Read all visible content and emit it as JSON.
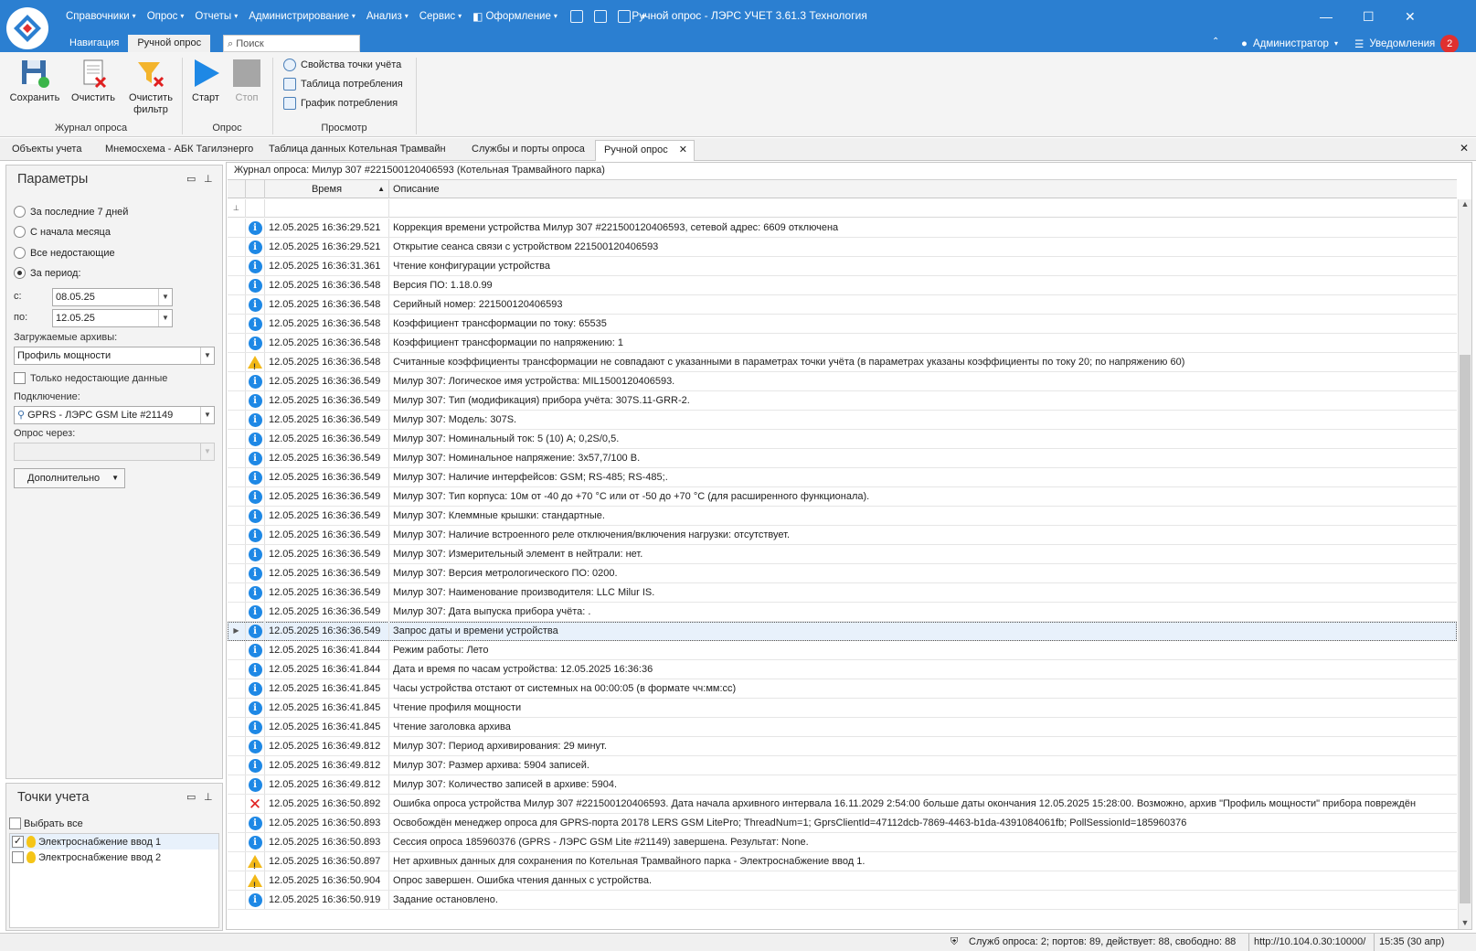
{
  "window": {
    "title": "Ручной опрос - ЛЭРС УЧЕТ 3.61.3 Технология"
  },
  "menu": [
    "Справочники",
    "Опрос",
    "Отчеты",
    "Администрирование",
    "Анализ",
    "Сервис",
    "Оформление"
  ],
  "ribbon_tabs": [
    "Навигация",
    "Ручной опрос"
  ],
  "search": {
    "placeholder": "Поиск"
  },
  "user": {
    "name": "Администратор",
    "notifications_label": "Уведомления",
    "notifications_count": "2"
  },
  "ribbon": {
    "save": "Сохранить",
    "clear": "Очистить",
    "clear_filter_1": "Очистить",
    "clear_filter_2": "фильтр",
    "start": "Старт",
    "stop": "Стоп",
    "group_journal": "Журнал опроса",
    "group_poll": "Опрос",
    "group_view": "Просмотр",
    "props": "Свойства точки учёта",
    "table": "Таблица потребления",
    "chart": "График потребления"
  },
  "doc_tabs": [
    "Объекты учета",
    "Мнемосхема - АБК Тагилэнерго",
    "Таблица данных Котельная Трамвайн",
    "Службы и порты опроса",
    "Ручной опрос"
  ],
  "params": {
    "title": "Параметры",
    "r1": "За последние 7 дней",
    "r2": "С начала месяца",
    "r3": "Все недостающие",
    "r4": "За период:",
    "from_label": "с:",
    "from_value": "08.05.25",
    "to_label": "по:",
    "to_value": "12.05.25",
    "archives_label": "Загружаемые архивы:",
    "archives_value": "Профиль мощности",
    "only_missing": "Только недостающие данные",
    "connection_label": "Подключение:",
    "connection_value": "GPRS - ЛЭРС GSM Lite #21149",
    "via_label": "Опрос через:",
    "advanced": "Дополнительно"
  },
  "points": {
    "title": "Точки учета",
    "select_all": "Выбрать все",
    "items": [
      "Электроснабжение ввод 1",
      "Электроснабжение ввод 2"
    ]
  },
  "journal": {
    "caption": "Журнал опроса: Милур 307 #221500120406593 (Котельная Трамвайного парка)",
    "col_time": "Время",
    "col_desc": "Описание",
    "rows": [
      {
        "t": "12.05.2025 16:36:29.521",
        "d": "Коррекция времени устройства Милур 307 #221500120406593, сетевой адрес: 6609 отключена"
      },
      {
        "t": "12.05.2025 16:36:29.521",
        "d": "Открытие сеанса связи с устройством 221500120406593"
      },
      {
        "t": "12.05.2025 16:36:31.361",
        "d": "Чтение конфигурации устройства"
      },
      {
        "t": "12.05.2025 16:36:36.548",
        "d": "Версия ПО: 1.18.0.99"
      },
      {
        "t": "12.05.2025 16:36:36.548",
        "d": "Серийный номер: 221500120406593"
      },
      {
        "t": "12.05.2025 16:36:36.548",
        "d": "Коэффициент трансформации по току: 65535"
      },
      {
        "t": "12.05.2025 16:36:36.548",
        "d": "Коэффициент трансформации по напряжению: 1"
      },
      {
        "t": "12.05.2025 16:36:36.548",
        "d": "Считанные коэффициенты трансформации не совпадают с указанными в параметрах точки учёта (в параметрах указаны коэффициенты по току 20; по напряжению 60)"
      },
      {
        "t": "12.05.2025 16:36:36.549",
        "d": "Милур 307: Логическое имя устройства: MIL1500120406593."
      },
      {
        "t": "12.05.2025 16:36:36.549",
        "d": "Милур 307: Тип (модификация) прибора учёта: 307S.11-GRR-2."
      },
      {
        "t": "12.05.2025 16:36:36.549",
        "d": "Милур 307: Модель: 307S."
      },
      {
        "t": "12.05.2025 16:36:36.549",
        "d": "Милур 307: Номинальный ток: 5 (10) А; 0,2S/0,5."
      },
      {
        "t": "12.05.2025 16:36:36.549",
        "d": "Милур 307: Номинальное напряжение: 3x57,7/100 В."
      },
      {
        "t": "12.05.2025 16:36:36.549",
        "d": "Милур 307: Наличие интерфейсов:  GSM; RS-485; RS-485;."
      },
      {
        "t": "12.05.2025 16:36:36.549",
        "d": "Милур 307: Тип корпуса: 10м от -40 до +70 °С или от -50 до +70 °С (для расширенного функционала)."
      },
      {
        "t": "12.05.2025 16:36:36.549",
        "d": "Милур 307: Клеммные крышки: стандартные."
      },
      {
        "t": "12.05.2025 16:36:36.549",
        "d": "Милур 307: Наличие встроенного реле отключения/включения нагрузки: отсутствует."
      },
      {
        "t": "12.05.2025 16:36:36.549",
        "d": "Милур 307: Измерительный элемент в нейтрали: нет."
      },
      {
        "t": "12.05.2025 16:36:36.549",
        "d": "Милур 307: Версия метрологического ПО: 0200."
      },
      {
        "t": "12.05.2025 16:36:36.549",
        "d": "Милур 307: Наименование производителя: LLC Milur IS."
      },
      {
        "t": "12.05.2025 16:36:36.549",
        "d": "Милур 307: Дата выпуска прибора учёта:                ."
      },
      {
        "t": "12.05.2025 16:36:36.549",
        "d": "Запрос даты и времени устройства"
      },
      {
        "t": "12.05.2025 16:36:41.844",
        "d": "Режим работы: Лето"
      },
      {
        "t": "12.05.2025 16:36:41.844",
        "d": "Дата и время по часам устройства: 12.05.2025 16:36:36"
      },
      {
        "t": "12.05.2025 16:36:41.845",
        "d": "Часы устройства отстают от системных на 00:00:05 (в формате чч:мм:сс)"
      },
      {
        "t": "12.05.2025 16:36:41.845",
        "d": "Чтение профиля мощности"
      },
      {
        "t": "12.05.2025 16:36:41.845",
        "d": "Чтение заголовка архива"
      },
      {
        "t": "12.05.2025 16:36:49.812",
        "d": "Милур 307: Период архивирования: 29 минут."
      },
      {
        "t": "12.05.2025 16:36:49.812",
        "d": "Милур 307: Размер архива: 5904 записей."
      },
      {
        "t": "12.05.2025 16:36:49.812",
        "d": "Милур 307: Количество записей в архиве: 5904."
      },
      {
        "t": "12.05.2025 16:36:50.892",
        "d": "Ошибка опроса устройства Милур 307 #221500120406593. Дата начала архивного интервала 16.11.2029 2:54:00 больше даты окончания 12.05.2025 15:28:00. Возможно, архив \"Профиль мощности\" прибора повреждён"
      },
      {
        "t": "12.05.2025 16:36:50.893",
        "d": "Освобождён менеджер опроса для GPRS-порта 20178 LERS GSM LitePro; ThreadNum=1; GprsClientId=47112dcb-7869-4463-b1da-4391084061fb; PollSessionId=185960376"
      },
      {
        "t": "12.05.2025 16:36:50.893",
        "d": "Сессия опроса 185960376 (GPRS - ЛЭРС GSM Lite #21149) завершена. Результат: None."
      },
      {
        "t": "12.05.2025 16:36:50.897",
        "d": "Нет архивных данных для сохранения по Котельная Трамвайного парка - Электроснабжение ввод 1."
      },
      {
        "t": "12.05.2025 16:36:50.904",
        "d": "Опрос завершен. Ошибка чтения данных с устройства."
      },
      {
        "t": "12.05.2025 16:36:50.919",
        "d": "Задание остановлено."
      }
    ]
  },
  "status": {
    "services": "Служб опроса: 2; портов: 89, действует: 88, свободно: 88",
    "url": "http://10.104.0.30:10000/",
    "time": "15:35 (30 апр)"
  },
  "icons": {
    "levels": [
      "info",
      "info",
      "info",
      "info",
      "info",
      "info",
      "info",
      "warn",
      "info",
      "info",
      "info",
      "info",
      "info",
      "info",
      "info",
      "info",
      "info",
      "info",
      "info",
      "info",
      "info",
      "info",
      "info",
      "info",
      "info",
      "info",
      "info",
      "info",
      "info",
      "info",
      "error",
      "info",
      "info",
      "warn",
      "warn",
      "info"
    ],
    "selected_row": 21
  },
  "colors": {
    "title_bar": "#2b7fd1",
    "info": "#1e88e5",
    "warning": "#f2b817",
    "error": "#e02020",
    "selected_row": "#e8f1fb"
  }
}
